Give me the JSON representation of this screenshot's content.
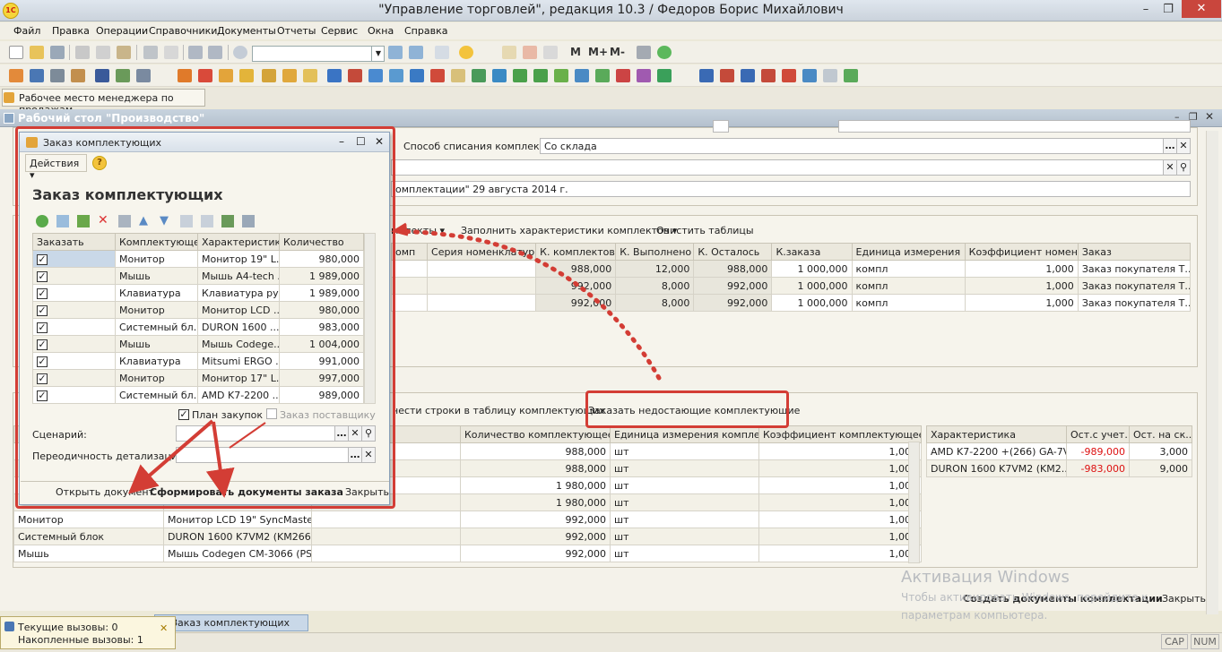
{
  "window": {
    "title": "\"Управление торговлей\", редакция 10.3 / Федоров Борис Михайлович",
    "logo_text": "1С"
  },
  "menu": [
    "Файл",
    "Правка",
    "Операции",
    "Справочники",
    "Документы",
    "Отчеты",
    "Сервис",
    "Окна",
    "Справка"
  ],
  "toolbar": {
    "memory_labels": [
      "M",
      "M+",
      "M-"
    ]
  },
  "panel_tab": "Рабочее место менеджера по продажам",
  "main_window": {
    "title": "Рабочий стол \"Производство\"",
    "write_off_label": "Способ списания комплекта:",
    "write_off_value": "Со склада",
    "doc_basis_text": "омплектации\" 29 августа 2014 г.",
    "top_commands": {
      "fill_chars": "мплекты",
      "fill_characteristics": "Заполнить характеристики комплектов",
      "clear_tables": "Очистить таблицы"
    },
    "kits_table": {
      "headers": [
        "омп",
        "Серия номенклатуры",
        "К. комплектов",
        "К. Выполнено",
        "К. Осталось",
        "К.заказа",
        "Единица измерения",
        "Коэффициент номен...",
        "Заказ"
      ],
      "rows": [
        [
          "",
          "",
          "988,000",
          "12,000",
          "988,000",
          "1 000,000",
          "компл",
          "1,000",
          "Заказ покупателя Т..."
        ],
        [
          "",
          "",
          "992,000",
          "8,000",
          "992,000",
          "1 000,000",
          "компл",
          "1,000",
          "Заказ покупателя Т..."
        ],
        [
          "",
          "",
          "992,000",
          "8,000",
          "992,000",
          "1 000,000",
          "компл",
          "1,000",
          "Заказ покупателя Т..."
        ]
      ]
    },
    "lower_commands": {
      "transfer_rows": "нести строки в таблицу комплектующих",
      "order_missing": "Заказать недостающие комплектующие"
    },
    "components_table": {
      "headers": [
        "",
        "",
        "ющего",
        "Количество комплектующее",
        "Единица измерения комплек...",
        "Коэффициент комплектующее"
      ],
      "rows": [
        [
          "",
          "",
          "",
          "988,000",
          "шт",
          "1,000"
        ],
        [
          "",
          "",
          "",
          "988,000",
          "шт",
          "1,000"
        ],
        [
          "",
          "",
          "",
          "1 980,000",
          "шт",
          "1,000"
        ],
        [
          "",
          "",
          "",
          "1 980,000",
          "шт",
          "1,000"
        ],
        [
          "Монитор",
          "Монитор LCD 19\" SyncMaster...",
          "",
          "992,000",
          "шт",
          "1,000"
        ],
        [
          "Системный блок",
          "DURON 1600  K7VM2 (KM266...",
          "",
          "992,000",
          "шт",
          "1,000"
        ],
        [
          "Мышь",
          "Мышь Codegen CM-3066 (PS/...",
          "",
          "992,000",
          "шт",
          "1,000"
        ]
      ]
    },
    "stock_table": {
      "headers": [
        "Характеристика",
        "Ост.с учет...",
        "Ост. на ск..."
      ],
      "rows": [
        [
          "AMD K7-2200 +(266) GA-7V...",
          "-989,000",
          "3,000"
        ],
        [
          "DURON 1600  K7VM2 (KM2...",
          "-983,000",
          "9,000"
        ]
      ]
    },
    "create_docs": "Создать документы комплектации",
    "close": "Закрыть"
  },
  "dialog": {
    "title": "Заказ комплектующих",
    "actions": "Действия",
    "help": "?",
    "heading": "Заказ комплектующих",
    "table": {
      "headers": [
        "Заказать",
        "Комплектующее",
        "Характеристика",
        "Количество"
      ],
      "rows": [
        [
          "Монитор",
          "Монитор 19\" L...",
          "980,000"
        ],
        [
          "Мышь",
          "Мышь A4-tech ...",
          "1 989,000"
        ],
        [
          "Клавиатура",
          "Клавиатура ру...",
          "1 989,000"
        ],
        [
          "Монитор",
          "Монитор LCD ...",
          "980,000"
        ],
        [
          "Системный бл...",
          "DURON 1600 ...",
          "983,000"
        ],
        [
          "Мышь",
          "Мышь Codege...",
          "1 004,000"
        ],
        [
          "Клавиатура",
          "Mitsumi ERGO ...",
          "991,000"
        ],
        [
          "Монитор",
          "Монитор 17\" L...",
          "997,000"
        ],
        [
          "Системный бл...",
          "AMD K7-2200 ...",
          "989,000"
        ]
      ]
    },
    "plan_purchases": "План закупок",
    "supplier_order": "Заказ поставщику",
    "scenario_label": "Сценарий:",
    "period_label": "Переодичность детализации:",
    "open_doc": "Открыть документ",
    "form_docs": "Сформировать документы заказа",
    "close": "Закрыть"
  },
  "calls": {
    "current": "Текущие вызовы: 0",
    "accumulated": "Накопленные вызовы: 1"
  },
  "taskbar_button": "Заказ комплектующих",
  "status": {
    "caps": "CAP",
    "num": "NUM"
  },
  "watermark": {
    "line1": "Активация Windows",
    "line2": "Чтобы активировать Windows, перейдите к",
    "line3": "параметрам компьютера."
  },
  "colors": {
    "annotation": "#d33d35",
    "accent": "#c9d8e8"
  }
}
